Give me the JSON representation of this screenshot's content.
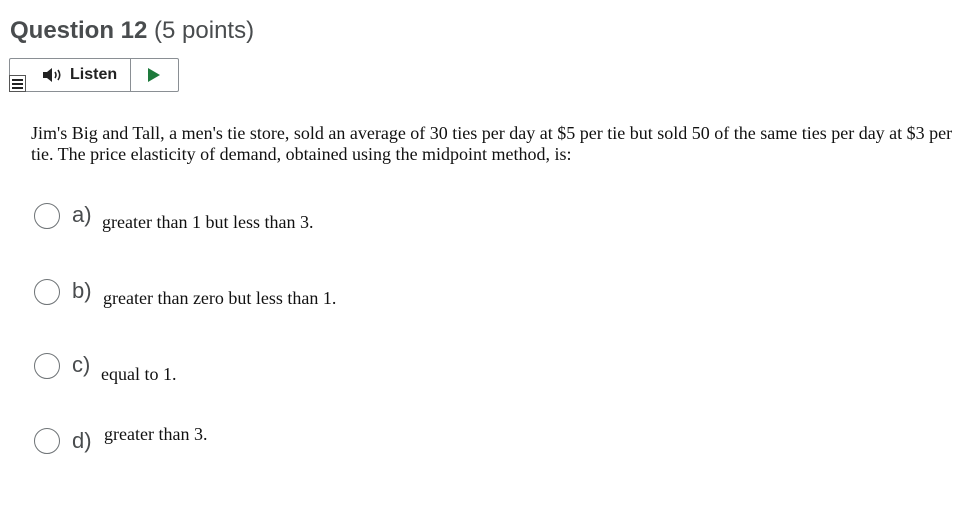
{
  "question": {
    "title": "Question 12",
    "points": "(5 points)",
    "prompt": "Jim's Big and Tall, a men's tie store, sold an average of 30 ties per day at $5 per tie but sold 50 of the same ties per day at $3 per tie. The price elasticity of demand, obtained using the midpoint method, is:"
  },
  "listen": {
    "label": "Listen",
    "speaker_icon": "speaker-icon",
    "play_icon": "play-icon",
    "menu_icon": "menu-icon",
    "play_color": "#1e7a3c"
  },
  "choices": [
    {
      "letter": "a)",
      "text": "greater than 1 but less than 3."
    },
    {
      "letter": "b)",
      "text": "greater than zero but less than 1."
    },
    {
      "letter": "c)",
      "text": "equal to 1."
    },
    {
      "letter": "d)",
      "text": "greater than 3."
    }
  ]
}
